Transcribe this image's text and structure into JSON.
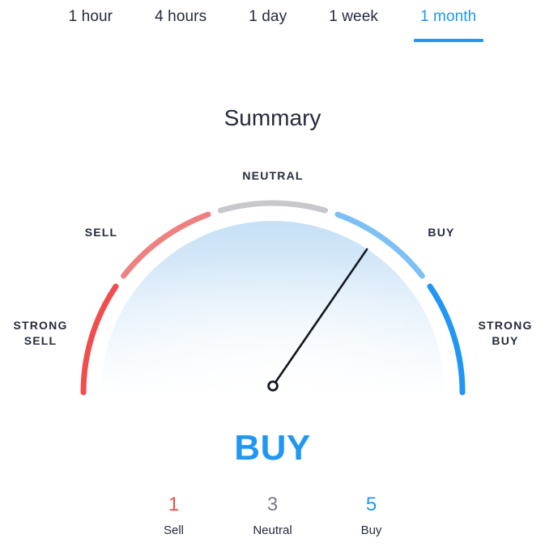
{
  "tabs": [
    {
      "label": "1 hour",
      "active": false
    },
    {
      "label": "4 hours",
      "active": false
    },
    {
      "label": "1 day",
      "active": false
    },
    {
      "label": "1 week",
      "active": false
    },
    {
      "label": "1 month",
      "active": true
    }
  ],
  "title": "Summary",
  "gauge": {
    "zones": [
      {
        "key": "strong_sell",
        "label": "STRONG\nSELL",
        "color": "#f04d4d"
      },
      {
        "key": "sell",
        "label": "SELL",
        "color": "#ef8080"
      },
      {
        "key": "neutral",
        "label": "NEUTRAL",
        "color": "#c8c8cc"
      },
      {
        "key": "buy",
        "label": "BUY",
        "color": "#7cc0f5"
      },
      {
        "key": "strong_buy",
        "label": "STRONG\nBUY",
        "color": "#2196f3"
      }
    ],
    "needle_angle_deg": 55.5,
    "needle_zone": "buy",
    "needle_color": "#131722",
    "fill_gradient_from": "#cfe5f7",
    "fill_gradient_to": "#fdfeff"
  },
  "verdict": {
    "text": "BUY",
    "color": "#2196f3"
  },
  "counts": [
    {
      "value": "1",
      "label": "Sell",
      "color": "#f04d4d"
    },
    {
      "value": "3",
      "label": "Neutral",
      "color": "#787b86"
    },
    {
      "value": "5",
      "label": "Buy",
      "color": "#2196f3"
    }
  ]
}
